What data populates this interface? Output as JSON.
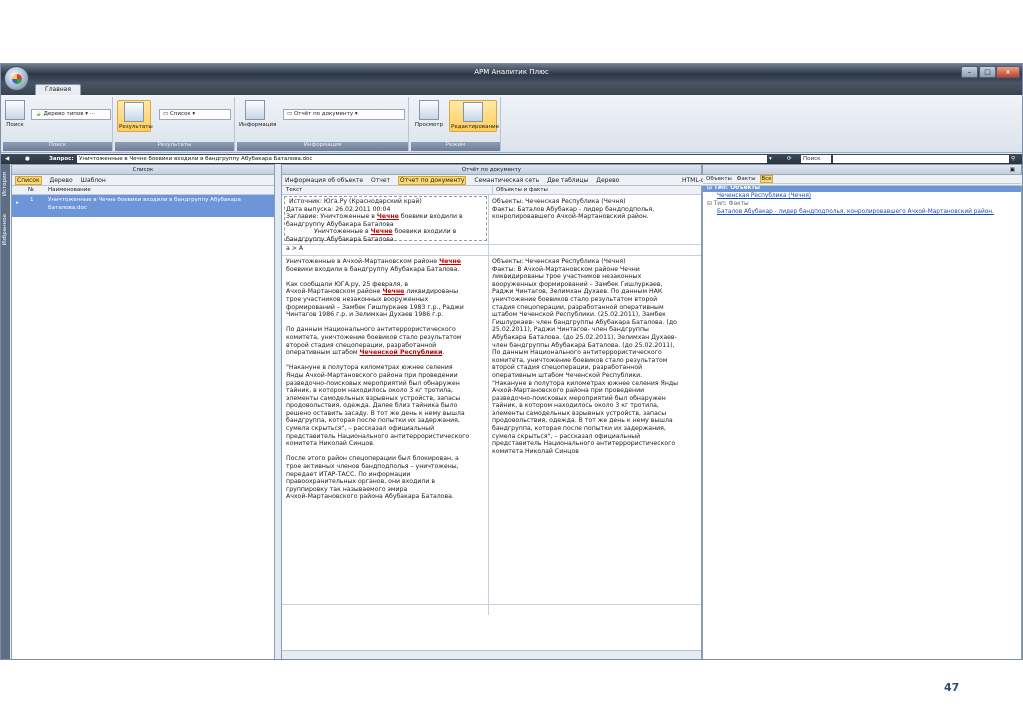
{
  "window": {
    "title": "АРМ Аналитик Плюс",
    "tab": "Главная"
  },
  "ribbon": {
    "search_label": "Поиск",
    "type_tree": "Дерево типов",
    "results_label": "Результаты",
    "list_combo": "Список",
    "group_search": "Поиск",
    "group_results": "Результаты",
    "info_label": "Информация",
    "report_combo": "Отчёт по документу",
    "group_info": "Информация",
    "view_label": "Просмотр",
    "edit_label": "Редактирование",
    "group_mode": "Режим"
  },
  "query": {
    "label": "Запрос:",
    "text": "Уничтоженные в Чечне боевики входили в бандгруппу Абубакара Баталова.doc",
    "search_placeholder": "Поиск"
  },
  "sidebar": {
    "history": "История",
    "favorites": "Избранное"
  },
  "list_pane": {
    "title": "Список",
    "tabs": [
      "Список",
      "Дерево",
      "Шаблон"
    ],
    "col_num": "№",
    "col_name": "Наименование",
    "rows": [
      {
        "num": "1",
        "name_l1": "Уничтоженные в Чечне боевики входили в бандгруппу Абубакара",
        "name_l2": "Баталова.doc"
      }
    ]
  },
  "report_pane": {
    "title": "Отчёт по документу",
    "toolbar": [
      "Информация об объекте",
      "Отчет",
      "Отчет по документу",
      "Семантическая сеть",
      "Две таблицы",
      "Дерево",
      "HTML-отчет"
    ],
    "col_text": "Текст",
    "col_facts": "Объекты и факты",
    "header_text": [
      "Источник: Юга.Ру (Краснодарский край)",
      "Дата выпуска: 26.02.2011 00:04"
    ],
    "header_text_title_pre": "Заглавие: Уничтоженные в ",
    "header_text_title_hl": "Чечне",
    "header_text_title_post": " боевики входили в",
    "header_text_title_l2": "бандгруппу Абубакара Баталова",
    "header_text_t2_pre": "Уничтоженные в ",
    "header_text_t2_post": " боевики входили в",
    "header_facts": [
      "Объекты: Чеченская Республика (Чечня)",
      "Факты: Баталов Абубакар - лидер бандподполья,",
      "конролировавшего Ачхой-Мартановский район."
    ],
    "marker": "а > А",
    "p1_pre": "Уничтоженные в Ачхой-Мартановском районе ",
    "p1_post": "боевики входили в бандгруппу Абубакара Баталова.",
    "p2_l1": "Как сообщали ЮГА.ру, 25 февраля, в",
    "p2_l2_pre": "Ачхой-Мартановском районе ",
    "p2_l2_post": " ликвидированы",
    "p2_rest": [
      "трое участников незаконных вооруженных",
      "формирований – Замбек Гишлуркаев 1983 г.р., Раджи",
      "Чинтагов 1986 г.р. и Зелимхан Духаев 1986 г.р."
    ],
    "p3": [
      "По данным Национального антитеррористического",
      "комитета, уничтожение боевиков стало результатом",
      "второй стадия спецоперации, разработанной"
    ],
    "p3_last_pre": "оперативным штабом ",
    "p3_last_hl": "Чеченской Республики",
    "p4": [
      "\"Накануне в полутора километрах южнее селения",
      "Янды Ачхой-Мартановского района при проведении",
      "разведочно-поисковых мероприятий был обнаружен",
      "тайник, в котором находилось около 3 кг тротила,",
      "элементы самодельных взрывных устройств, запасы",
      "продовольствия, одежда. Далее близ тайника было",
      "решено оставить засаду. В тот же день к нему вышла",
      "бандгруппа, которая после попытки их задержания,",
      "сумела скрыться\", – рассказал официальный",
      "представитель Национального антитеррористического",
      "комитета Николай Синцов."
    ],
    "p5": [
      "После этого район спецоперации был блокирован, а",
      "трое активных членов бандподполья – уничтожены,",
      "передает ИТАР-ТАСС. По информации",
      "правоохранительных органов, они входили в",
      "группировку так называемого эмира",
      "Ачхой-Мартановского района Абубакара Баталова."
    ],
    "facts_body": [
      "Объекты: Чеченская Республика (Чечня)",
      "Факты: В Ачхой-Мартановском районе Чечни",
      "ликвидированы трое участников незаконных",
      "вооруженных формирований – Замбек Гишлуркаев,",
      "Раджи Чинтагов, Зелимхан Духаев. По данным НАК",
      "уничтожение боевиков стало результатом второй",
      "стадия спецоперации, разработанной оперативным",
      "штабом Чеченской Республики. (25.02.2011), Замбек",
      "Гишлуркаев- член бандгруппы Абубакара Баталова. (до",
      "25.02.2011), Раджи Чинтагов- член бандгруппы",
      "Абубакара Баталова. (до 25.02.2011), Зелимхан Духаев-",
      "член бандгруппы Абубакара Баталова. (до 25.02.2011),",
      "По данным Национального антитеррористического",
      "комитета, уничтожение боевиков стало результатом",
      "второй стадия спецоперации, разработанной",
      "оперативным штабом Чеченской Республики.",
      "\"Накануне в полутора километрах южнее селения Янды",
      "Ачхой-Мартановского района при проведении",
      "разведочно-поисковых мероприятий был обнаружен",
      "тайник, в котором находилось около 3 кг тротила,",
      "элементы самодельных взрывных устройств, запасы",
      "продовольствия, одежда. В тот же день к нему вышла",
      "бандгруппа, которая после попытки их задержания,",
      "сумела скрыться\", – рассказал официальный",
      "представитель Национального антитеррористического",
      "комитета Николай Синцов"
    ]
  },
  "objects_pane": {
    "tabs": [
      "Объекты",
      "Факты",
      "Все"
    ],
    "type_objects": "Тип: Объекты",
    "obj1": "Чеченская Республика (Чечня)",
    "type_facts": "Тип: Факты",
    "fact1": "Баталов Абубакар - лидер бандподполья, конролировавшего Ачхой-Мартановский район."
  },
  "slide": {
    "page": "47"
  }
}
